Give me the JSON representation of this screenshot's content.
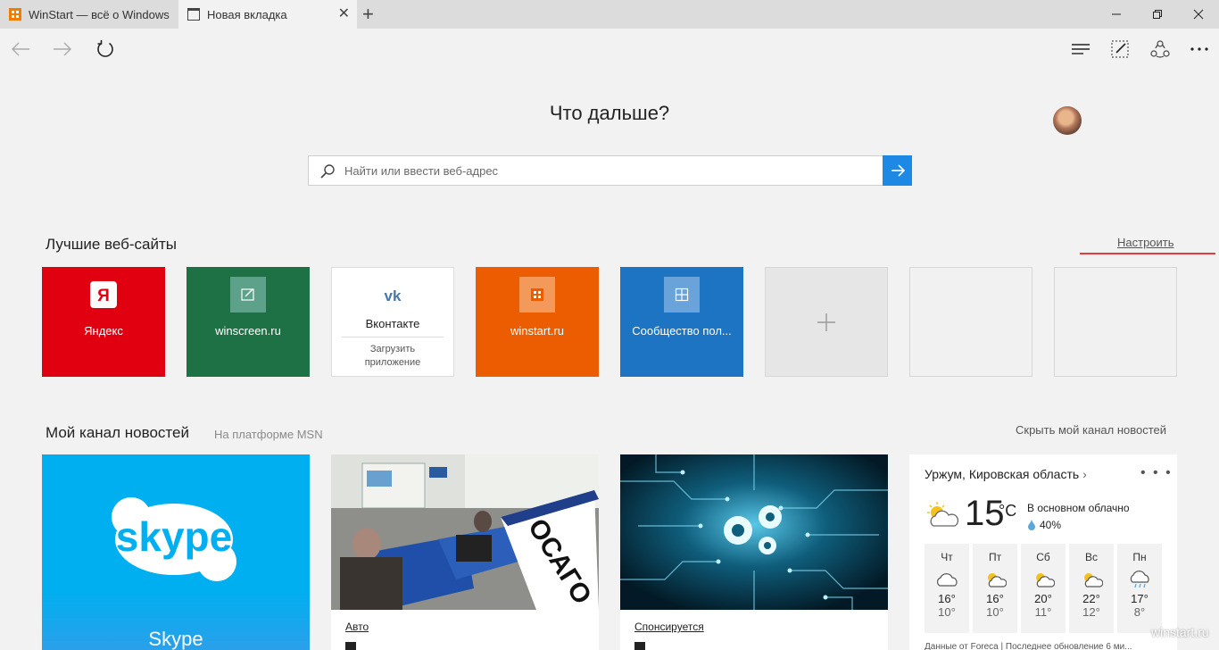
{
  "tabs": [
    {
      "title": "WinStart — всё о Windows",
      "active": false
    },
    {
      "title": "Новая вкладка",
      "active": true
    }
  ],
  "page": {
    "heading": "Что дальше?",
    "search_placeholder": "Найти или ввести веб-адрес"
  },
  "top_sites": {
    "title": "Лучшие веб-сайты",
    "customize": "Настроить",
    "items": [
      {
        "label": "Яндекс",
        "color": "#e1000f",
        "icon": "yandex-icon"
      },
      {
        "label": "winscreen.ru",
        "color": "#1e7145",
        "icon": "winscreen-icon"
      },
      {
        "label": "Вконтакте",
        "sub": "Загрузить приложение",
        "color": "#ffffff",
        "icon": "vk-icon"
      },
      {
        "label": "winstart.ru",
        "color": "#eb5d00",
        "icon": "winstart-icon"
      },
      {
        "label": "Сообщество пол...",
        "color": "#1d74c2",
        "icon": "community-icon"
      }
    ]
  },
  "news": {
    "title": "Мой канал новостей",
    "platform": "На платформе MSN",
    "hide": "Скрыть мой канал новостей",
    "cards": [
      {
        "title": "Skype",
        "category": ""
      },
      {
        "category": "Авто",
        "sign": "ОСАГО"
      },
      {
        "category": "Спонсируется"
      }
    ]
  },
  "weather": {
    "location": "Уржум, Кировская область",
    "temp": "15",
    "unit": "°C",
    "condition": "В основном облачно",
    "humidity": "40%",
    "days": [
      {
        "name": "Чт",
        "hi": "16°",
        "lo": "10°",
        "icon": "cloud-icon"
      },
      {
        "name": "Пт",
        "hi": "16°",
        "lo": "10°",
        "icon": "partly-sunny-icon"
      },
      {
        "name": "Сб",
        "hi": "20°",
        "lo": "11°",
        "icon": "partly-sunny-icon"
      },
      {
        "name": "Вс",
        "hi": "22°",
        "lo": "12°",
        "icon": "partly-sunny-icon"
      },
      {
        "name": "Пн",
        "hi": "17°",
        "lo": "8°",
        "icon": "rain-icon"
      }
    ],
    "source": "Данные от Foreca | Последнее обновление 6 ми..."
  },
  "watermark": "winstart.ru"
}
